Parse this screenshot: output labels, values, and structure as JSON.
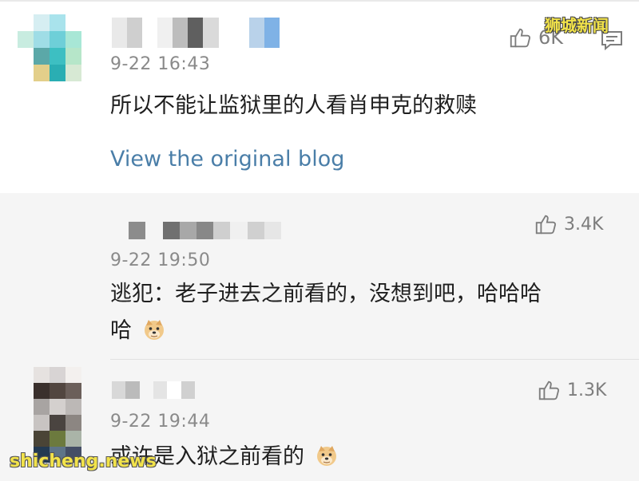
{
  "watermark_top": "狮城新闻",
  "watermark_bottom": "shicheng.news",
  "main_comment": {
    "avatar_colors": [
      "#ffffff",
      "#d6eef2",
      "#a9e3ec",
      "#ffffff",
      "#c8ece0",
      "#9fdde6",
      "#6ecfd8",
      "#a8e7d6",
      "#ffffff",
      "#5ba8a8",
      "#3dbfc2",
      "#b6e6c9",
      "#ffffff",
      "#e3cf8a",
      "#2aaeb3",
      "#d7e9d4"
    ],
    "name_colors": [
      "#e9e9e9",
      "#cfcfcf",
      "#ffffff",
      "#f0f0f0",
      "#bdbdbd",
      "#5f5f5f",
      "#dadada",
      "#ffffff",
      "#ffffff",
      "#b9d2ea",
      "#7fb2e6"
    ],
    "timestamp": "9-22 16:43",
    "text": "所以不能让监狱里的人看肖申克的救赎",
    "likes": "6K",
    "view_link": "View the original blog",
    "icons": {
      "like": "thumbs-up-icon",
      "reply": "comment-bubble-icon"
    }
  },
  "replies": [
    {
      "avatar_colors": [
        "#d9c9a0",
        "#e8d8a8",
        "#ffffff",
        "#bfae86",
        "#2e2a22",
        "#8a8c7a",
        "#4a4436",
        "#6c7a3e",
        "#aab4a8",
        "#233a52",
        "#5e7488",
        "#444e66"
      ],
      "name_colors": [
        "#f5f5f5",
        "#8c8c8c",
        "#f5f5f5",
        "#707070",
        "#a8a8a8",
        "#888888",
        "#cfcfcf",
        "#f0f0f0",
        "#d0d0d0",
        "#e6e6e6"
      ],
      "timestamp": "9-22 19:50",
      "text_line1": "逃犯：老子进去之前看的，没想到吧，哈哈哈",
      "text_line2": "哈",
      "likes": "3.4K",
      "emoji": "doge-emoji"
    },
    {
      "avatar_colors": [
        "#e6e2e0",
        "#d8d4d4",
        "#f3f0ee",
        "#3a302c",
        "#524640",
        "#6b5f5a",
        "#a8a4a2",
        "#d4d0ce",
        "#bcb8b6",
        "#c8c4c2",
        "#4a4440",
        "#8c8682"
      ],
      "name_colors": [
        "#d8d8d8",
        "#bbbbbb",
        "#f5f5f5",
        "#e4e4e4",
        "#ffffff",
        "#d0d0d0"
      ],
      "timestamp": "9-22 19:44",
      "text": "或许是入狱之前看的",
      "likes": "1.3K",
      "emoji": "doge-emoji"
    }
  ]
}
